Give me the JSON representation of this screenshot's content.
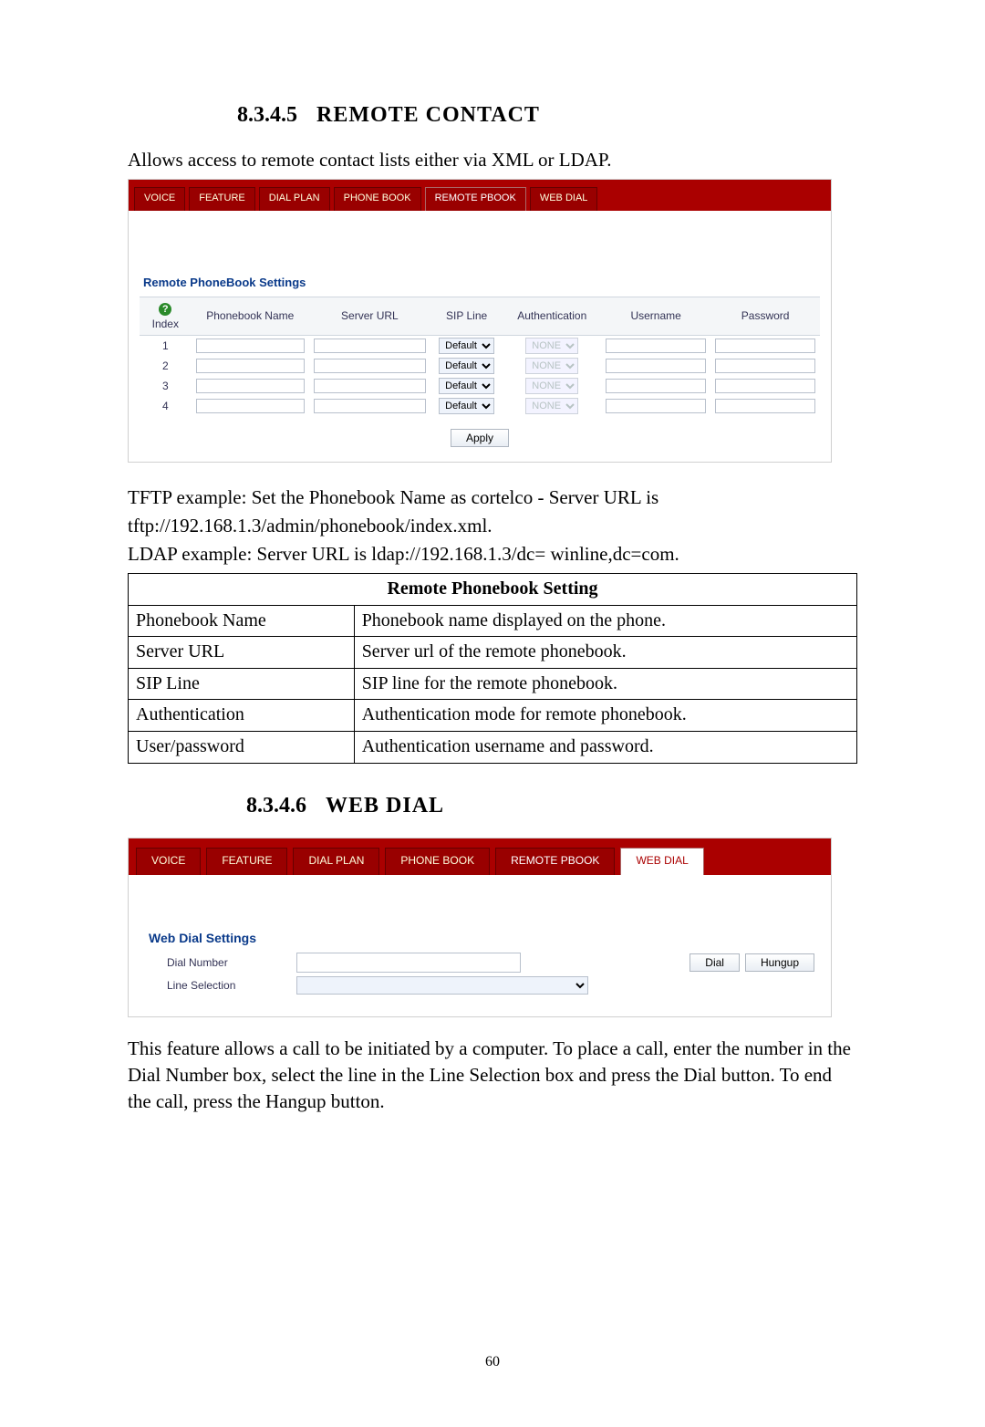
{
  "section1": {
    "num": "8.3.4.5",
    "title": "REMOTE CONTACT"
  },
  "intro1": "Allows access to remote contact lists either via XML or LDAP.",
  "tabs": {
    "voice": "VOICE",
    "feature": "FEATURE",
    "dialplan": "DIAL PLAN",
    "phonebook": "PHONE BOOK",
    "remote": "REMOTE PBOOK",
    "webdial": "WEB DIAL"
  },
  "ui1": {
    "caption": "Remote PhoneBook Settings",
    "headers": {
      "index": "Index",
      "name": "Phonebook Name",
      "url": "Server URL",
      "sip": "SIP Line",
      "auth": "Authentication",
      "user": "Username",
      "pass": "Password"
    },
    "rows": [
      {
        "idx": "1",
        "sip": "Default",
        "auth": "NONE"
      },
      {
        "idx": "2",
        "sip": "Default",
        "auth": "NONE"
      },
      {
        "idx": "3",
        "sip": "Default",
        "auth": "NONE"
      },
      {
        "idx": "4",
        "sip": "Default",
        "auth": "NONE"
      }
    ],
    "apply": "Apply"
  },
  "post1a": "TFTP example: Set the Phonebook Name as cortelco - Server URL is",
  "post1b": "tftp://192.168.1.3/admin/phonebook/index.xml.",
  "post1c": "LDAP example: Server URL is ldap://192.168.1.3/dc= winline,dc=com.",
  "def": {
    "title": "Remote Phonebook Setting",
    "rows": [
      {
        "k": "Phonebook Name",
        "v": "Phonebook name displayed on the phone."
      },
      {
        "k": "Server URL",
        "v": "Server url of the remote phonebook."
      },
      {
        "k": "SIP Line",
        "v": "SIP line for the remote phonebook."
      },
      {
        "k": "Authentication",
        "v": "Authentication mode for remote phonebook."
      },
      {
        "k": "User/password",
        "v": "Authentication username and password."
      }
    ]
  },
  "section2": {
    "num": "8.3.4.6",
    "title": "WEB DIAL"
  },
  "ui2": {
    "caption": "Web Dial Settings",
    "dial_number": "Dial Number",
    "line_sel": "Line Selection",
    "dial_btn": "Dial",
    "hangup_btn": "Hungup"
  },
  "post2": "This feature allows a call to be initiated by a computer.   To place a call, enter the number in the Dial Number box, select the line in the Line Selection box and press the Dial button.   To end the call, press the Hangup button.",
  "pagenum": "60"
}
